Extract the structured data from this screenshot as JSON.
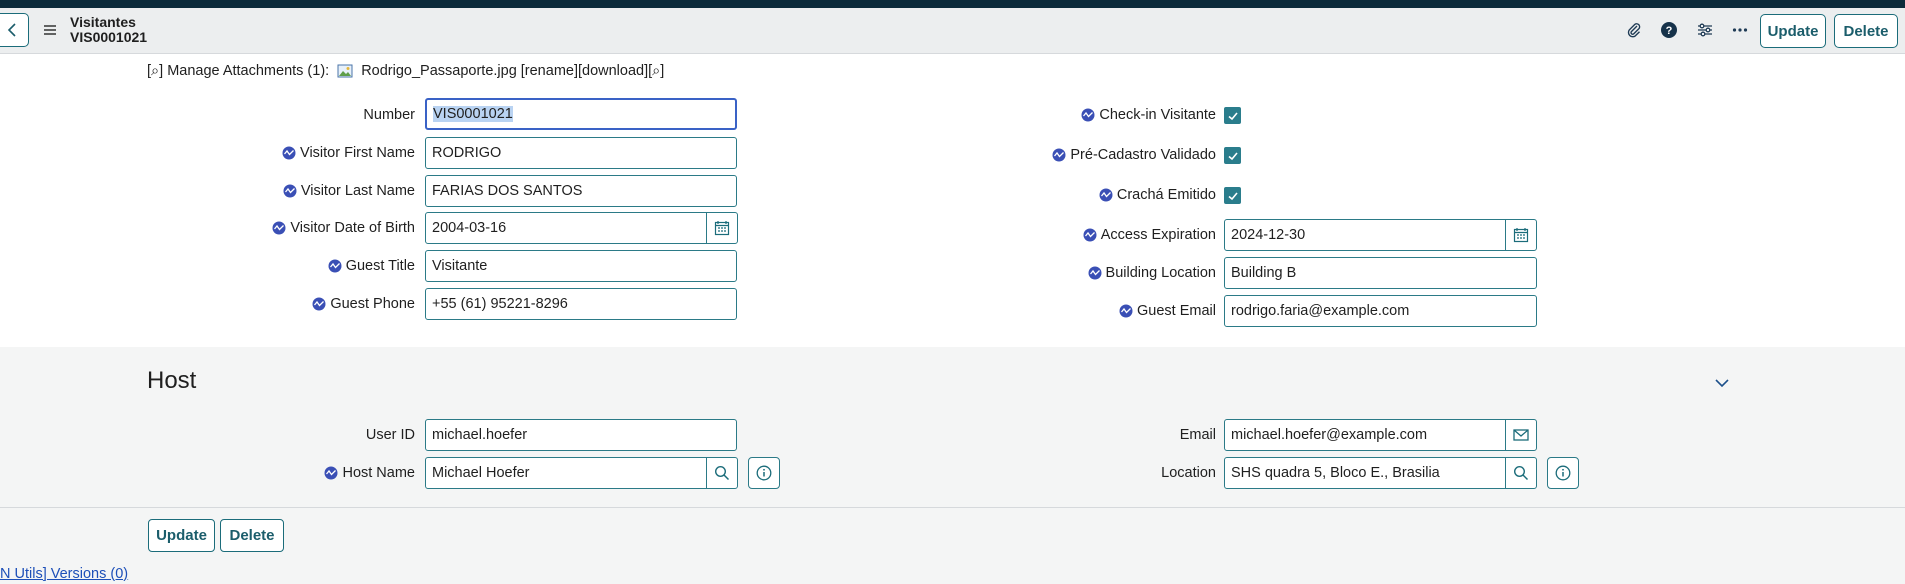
{
  "header": {
    "title_line1": "Visitantes",
    "title_line2": "VIS0001021",
    "update_label": "Update",
    "delete_label": "Delete"
  },
  "attachments": {
    "prefix": "[⌕]",
    "manage_label": "Manage Attachments (1):",
    "file_name": "Rodrigo_Passaporte.jpg",
    "actions": "[rename][download][⌕]"
  },
  "form_left": {
    "number_label": "Number",
    "number_value": "VIS0001021",
    "first_name_label": "Visitor First Name",
    "first_name_value": "RODRIGO",
    "last_name_label": "Visitor Last Name",
    "last_name_value": "FARIAS DOS SANTOS",
    "dob_label": "Visitor Date of Birth",
    "dob_value": "2004-03-16",
    "guest_title_label": "Guest Title",
    "guest_title_value": "Visitante",
    "guest_phone_label": "Guest Phone",
    "guest_phone_value": "+55 (61) 95221-8296"
  },
  "form_right": {
    "checkin_label": "Check-in Visitante",
    "checkin_checked": true,
    "precadastro_label": "Pré-Cadastro Validado",
    "precadastro_checked": true,
    "cracha_label": "Crachá Emitido",
    "cracha_checked": true,
    "access_exp_label": "Access Expiration",
    "access_exp_value": "2024-12-30",
    "building_label": "Building Location",
    "building_value": "Building B",
    "guest_email_label": "Guest Email",
    "guest_email_value": "rodrigo.faria@example.com"
  },
  "host": {
    "section_title": "Host",
    "user_id_label": "User ID",
    "user_id_value": "michael.hoefer",
    "host_name_label": "Host Name",
    "host_name_value": "Michael Hoefer",
    "email_label": "Email",
    "email_value": "michael.hoefer@example.com",
    "location_label": "Location",
    "location_value": "SHS quadra 5, Bloco E., Brasilia"
  },
  "footer": {
    "update_label": "Update",
    "delete_label": "Delete",
    "versions_link": "N Utils] Versions (0)"
  },
  "colors": {
    "accent": "#1b6c7a",
    "checkbox": "#2a7d8c",
    "focus": "#3a62c6",
    "link": "#1d4fb8",
    "topbar": "#0c2b3b"
  }
}
